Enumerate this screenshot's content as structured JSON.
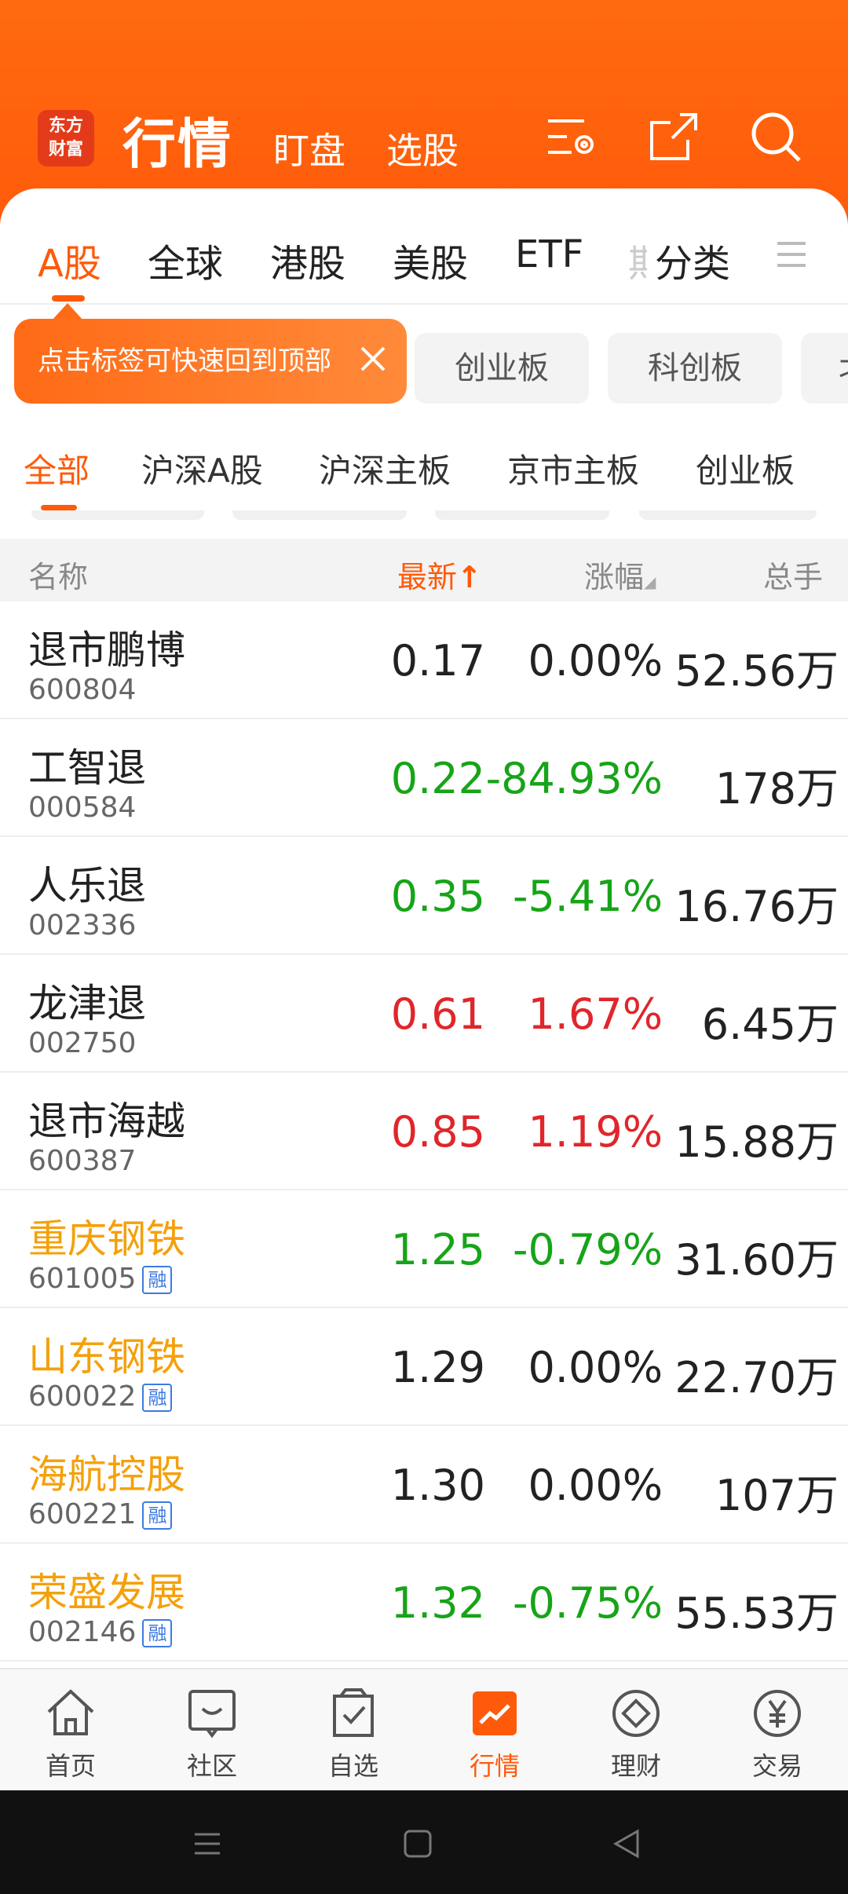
{
  "header": {
    "logo_line1": "东方",
    "logo_line2": "财富",
    "title": "行情",
    "links": [
      "盯盘",
      "选股"
    ]
  },
  "market_tabs": [
    "A股",
    "全球",
    "港股",
    "美股",
    "ETF",
    "期",
    "分类"
  ],
  "tooltip": {
    "text": "点击标签可快速回到顶部"
  },
  "board_chips": [
    "创业板",
    "科创板",
    "北"
  ],
  "sub_tabs": [
    "全部",
    "沪深A股",
    "沪深主板",
    "京市主板",
    "创业板"
  ],
  "table": {
    "columns": {
      "name": "名称",
      "latest": "最新",
      "change": "涨幅",
      "volume": "总手"
    },
    "rows": [
      {
        "name": "退市鹏博",
        "code": "600804",
        "price": "0.17",
        "change": "0.00%",
        "volume": "52.56万",
        "trend": "flat",
        "margin": false,
        "highlight": false
      },
      {
        "name": "工智退",
        "code": "000584",
        "price": "0.22",
        "change": "-84.93%",
        "volume": "178万",
        "trend": "down",
        "margin": false,
        "highlight": false
      },
      {
        "name": "人乐退",
        "code": "002336",
        "price": "0.35",
        "change": "-5.41%",
        "volume": "16.76万",
        "trend": "down",
        "margin": false,
        "highlight": false
      },
      {
        "name": "龙津退",
        "code": "002750",
        "price": "0.61",
        "change": "1.67%",
        "volume": "6.45万",
        "trend": "up",
        "margin": false,
        "highlight": false
      },
      {
        "name": "退市海越",
        "code": "600387",
        "price": "0.85",
        "change": "1.19%",
        "volume": "15.88万",
        "trend": "up",
        "margin": false,
        "highlight": false
      },
      {
        "name": "重庆钢铁",
        "code": "601005",
        "price": "1.25",
        "change": "-0.79%",
        "volume": "31.60万",
        "trend": "down",
        "margin": true,
        "highlight": true
      },
      {
        "name": "山东钢铁",
        "code": "600022",
        "price": "1.29",
        "change": "0.00%",
        "volume": "22.70万",
        "trend": "flat",
        "margin": true,
        "highlight": true
      },
      {
        "name": "海航控股",
        "code": "600221",
        "price": "1.30",
        "change": "0.00%",
        "volume": "107万",
        "trend": "flat",
        "margin": true,
        "highlight": true
      },
      {
        "name": "荣盛发展",
        "code": "002146",
        "price": "1.32",
        "change": "-0.75%",
        "volume": "55.53万",
        "trend": "down",
        "margin": true,
        "highlight": true
      }
    ],
    "margin_badge": "融"
  },
  "bottom_nav": [
    {
      "label": "首页",
      "icon": "home-icon"
    },
    {
      "label": "社区",
      "icon": "community-icon"
    },
    {
      "label": "自选",
      "icon": "watchlist-icon"
    },
    {
      "label": "行情",
      "icon": "market-icon",
      "active": true
    },
    {
      "label": "理财",
      "icon": "wealth-icon"
    },
    {
      "label": "交易",
      "icon": "trade-icon"
    }
  ],
  "colors": {
    "accent": "#ff5a0a",
    "up": "#e0262b",
    "down": "#17a418",
    "highlight_name": "#f5a00a"
  }
}
